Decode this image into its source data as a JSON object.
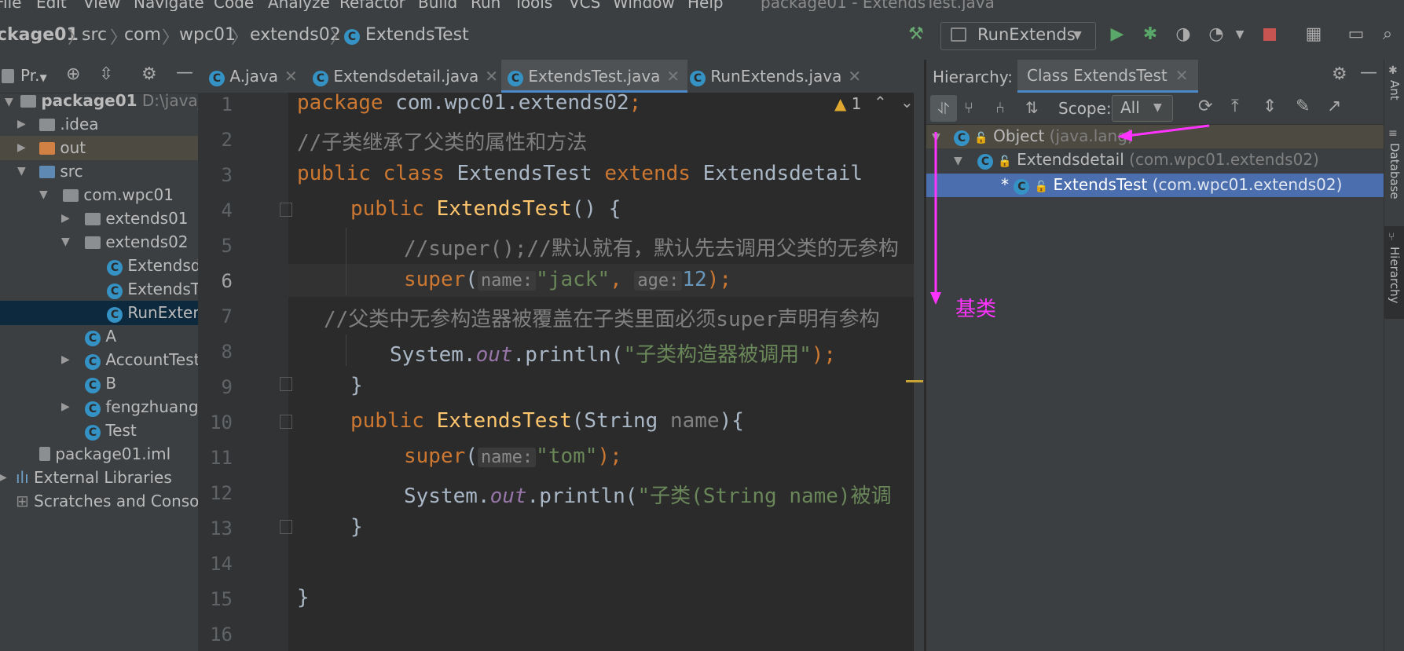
{
  "menu": [
    "File",
    "Edit",
    "View",
    "Navigate",
    "Code",
    "Analyze",
    "Refactor",
    "Build",
    "Run",
    "Tools",
    "VCS",
    "Window",
    "Help"
  ],
  "window_title": "package01 - ExtendsTest.java",
  "breadcrumb": [
    "ckage01",
    "src",
    "com",
    "wpc01",
    "extends02",
    "ExtendsTest"
  ],
  "run_config": "RunExtends",
  "project_panel": {
    "title": "Pr.",
    "tree": [
      {
        "label": "package01",
        "extra": "D:\\java_c"
      },
      {
        "label": ".idea"
      },
      {
        "label": "out"
      },
      {
        "label": "src"
      },
      {
        "label": "com.wpc01"
      },
      {
        "label": "extends01"
      },
      {
        "label": "extends02"
      },
      {
        "label": "Extendsd"
      },
      {
        "label": "ExtendsT"
      },
      {
        "label": "RunExten"
      },
      {
        "label": "A"
      },
      {
        "label": "AccountTest"
      },
      {
        "label": "B"
      },
      {
        "label": "fengzhuang"
      },
      {
        "label": "Test"
      },
      {
        "label": "package01.iml"
      },
      {
        "label": "External Libraries"
      },
      {
        "label": "Scratches and Consoles"
      }
    ]
  },
  "tabs": [
    {
      "label": "A.java"
    },
    {
      "label": "Extendsdetail.java"
    },
    {
      "label": "ExtendsTest.java"
    },
    {
      "label": "RunExtends.java"
    }
  ],
  "editor": {
    "line_numbers": [
      "1",
      "2",
      "3",
      "4",
      "5",
      "6",
      "7",
      "8",
      "9",
      "10",
      "11",
      "12",
      "13",
      "14",
      "15",
      "16"
    ],
    "warning_count": "1",
    "lines": {
      "l1_kw": "package",
      "l1_rest": " com.wpc01.extends02",
      "l1_semi": ";",
      "l2": "//子类继承了父类的属性和方法",
      "l3_kw1": "public class",
      "l3_name": " ExtendsTest ",
      "l3_kw2": "extends",
      "l3_rest": " Extendsdetail",
      "l4_kw": "public",
      "l4_fn": " ExtendsTest",
      "l4_rest": "() {",
      "l5": "//super();//默认就有，默认先去调用父类的无参构",
      "l6_kw": "super",
      "l6_paren": "(",
      "l6_hint1": "name:",
      "l6_str": "\"jack\"",
      "l6_comma": ",",
      "l6_hint2": "age:",
      "l6_num": "12",
      "l6_end": ");",
      "l7": "//父类中无参构造器被覆盖在子类里面必须super声明有参构",
      "l8_pre": "System.",
      "l8_out": "out",
      "l8_mid": ".println(",
      "l8_str": "\"子类构造器被调用\"",
      "l8_end": ");",
      "l9": "}",
      "l10_kw": "public",
      "l10_fn": " ExtendsTest",
      "l10_pre": "(String ",
      "l10_param": "name",
      "l10_end": "){",
      "l11_kw": "super",
      "l11_paren": "(",
      "l11_hint": "name:",
      "l11_str": "\"tom\"",
      "l11_end": ");",
      "l12_pre": "System.",
      "l12_out": "out",
      "l12_mid": ".println(",
      "l12_str": "\"子类(String name)被调",
      "l13": "}",
      "l15": "}"
    }
  },
  "hierarchy": {
    "label": "Hierarchy:",
    "tab": "Class ExtendsTest",
    "scope_label": "Scope:",
    "scope_value": "All",
    "rows": [
      {
        "name": "Object",
        "pkg": "(java.lang)"
      },
      {
        "name": "Extendsdetail",
        "pkg": "(com.wpc01.extends02)"
      },
      {
        "prefix": "*",
        "name": "ExtendsTest",
        "pkg": "(com.wpc01.extends02)"
      }
    ],
    "annotation": "基类"
  },
  "side_tools": [
    "Ant",
    "Database",
    "Hierarchy"
  ],
  "colors": {
    "annotation": "#ff33ff",
    "selection": "#4b6eaf",
    "keyword": "#cc7832",
    "string": "#6a8759"
  }
}
